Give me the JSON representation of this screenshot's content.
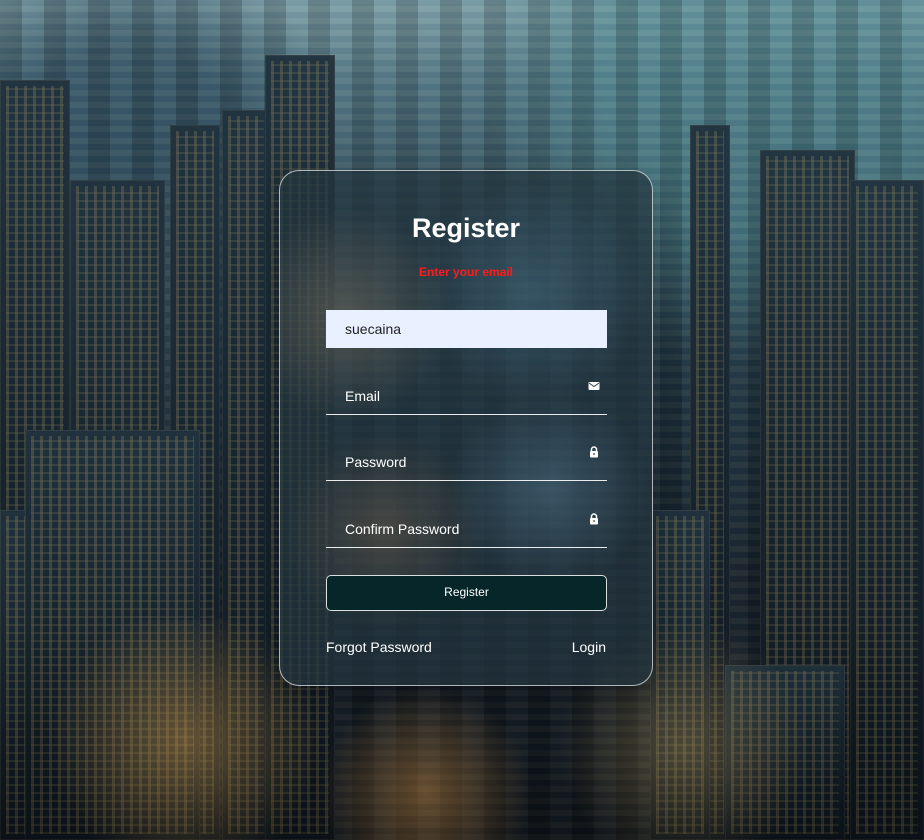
{
  "page": {
    "title": "Register",
    "error_text": "Enter your email"
  },
  "form": {
    "username_value": "suecaina",
    "email_placeholder": "Email",
    "password_placeholder": "Password",
    "confirm_password_placeholder": "Confirm Password",
    "register_button": "Register"
  },
  "links": {
    "forgot_password": "Forgot Password",
    "login": "Login"
  },
  "icons": {
    "email": "mail-icon",
    "password": "lock-icon",
    "confirm_password": "lock-icon"
  },
  "colors": {
    "error": "#ff1b1b",
    "input_fill": "#e9f0ff",
    "button_fill": "#06262a",
    "text": "#ffffff"
  }
}
